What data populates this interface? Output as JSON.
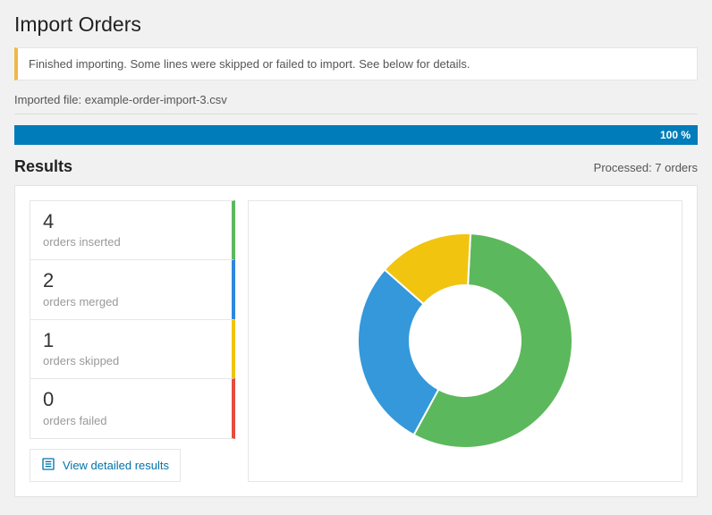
{
  "page_title": "Import Orders",
  "notice_text": "Finished importing. Some lines were skipped or failed to import. See below for details.",
  "imported_file_label": "Imported file: example-order-import-3.csv",
  "progress_text": "100 %",
  "results_title": "Results",
  "processed_text": "Processed: 7 orders",
  "stats": {
    "inserted": {
      "value": "4",
      "label": "orders inserted"
    },
    "merged": {
      "value": "2",
      "label": "orders merged"
    },
    "skipped": {
      "value": "1",
      "label": "orders skipped"
    },
    "failed": {
      "value": "0",
      "label": "orders failed"
    }
  },
  "view_detailed_label": "View detailed results",
  "colors": {
    "inserted": "#5cb85c",
    "merged": "#3498db",
    "skipped": "#f1c40f",
    "failed": "#e74c3c",
    "brand": "#007cba"
  },
  "chart_data": {
    "type": "pie",
    "title": "",
    "series": [
      {
        "name": "orders inserted",
        "value": 4,
        "color": "#5cb85c"
      },
      {
        "name": "orders merged",
        "value": 2,
        "color": "#3498db"
      },
      {
        "name": "orders skipped",
        "value": 1,
        "color": "#f1c40f"
      },
      {
        "name": "orders failed",
        "value": 0,
        "color": "#e74c3c"
      }
    ],
    "donut": true
  }
}
